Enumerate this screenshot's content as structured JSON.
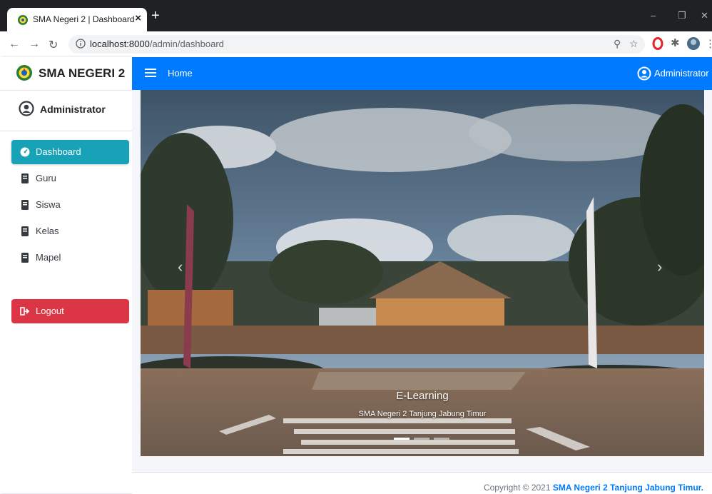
{
  "browser": {
    "tab_title": "SMA Negeri 2 | Dashboard",
    "tab_close": "×",
    "new_tab": "+",
    "url_host": "localhost:8000",
    "url_path": "/admin/dashboard"
  },
  "sidebar": {
    "brand": "SMA NEGERI 2",
    "user": "Administrator",
    "items": [
      {
        "label": "Dashboard",
        "icon": "tachometer-icon",
        "active": true
      },
      {
        "label": "Guru",
        "icon": "book-icon"
      },
      {
        "label": "Siswa",
        "icon": "book-icon"
      },
      {
        "label": "Kelas",
        "icon": "book-icon"
      },
      {
        "label": "Mapel",
        "icon": "book-icon"
      }
    ],
    "logout": "Logout"
  },
  "topnav": {
    "home": "Home",
    "user": "Administrator"
  },
  "carousel": {
    "title": "E-Learning",
    "subtitle": "SMA Negeri 2 Tanjung Jabung Timur",
    "slides": 3,
    "active_slide": 1
  },
  "footer": {
    "prefix": "Copyright © 2021",
    "link": "SMA Negeri 2 Tanjung Jabung Timur."
  },
  "colors": {
    "primary": "#007bff",
    "active": "#17a2b8",
    "danger": "#dc3545"
  }
}
